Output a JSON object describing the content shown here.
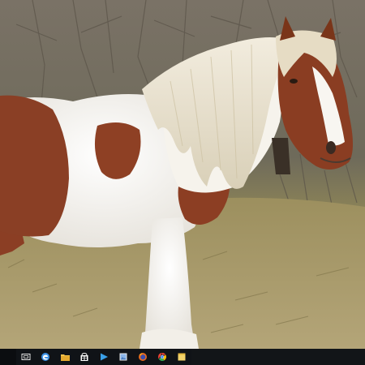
{
  "wallpaper": {
    "subject": "horse-photo",
    "colors": {
      "sky_trees": "#7d7466",
      "grass": "#9a8d5f",
      "coat_brown": "#8a3f25",
      "coat_white": "#f5f3ef",
      "mane": "#ece7d8"
    }
  },
  "taskbar": {
    "background": "#101317",
    "buttons": [
      {
        "name": "task-view",
        "icon": "task-view-icon"
      },
      {
        "name": "edge",
        "icon": "edge-icon",
        "color": "#3a8fe3"
      },
      {
        "name": "file-explorer",
        "icon": "folder-icon",
        "color": "#f1c24b"
      },
      {
        "name": "store",
        "icon": "store-icon",
        "color": "#ffffff"
      },
      {
        "name": "media-player",
        "icon": "play-icon",
        "color": "#3aa0e8"
      },
      {
        "name": "photos",
        "icon": "image-viewer-icon",
        "color": "#8ab4e8"
      },
      {
        "name": "firefox",
        "icon": "firefox-icon",
        "color": "#e66a1f"
      },
      {
        "name": "chrome",
        "icon": "chrome-icon",
        "color": "#34a853"
      },
      {
        "name": "notes",
        "icon": "sticky-note-icon",
        "color": "#f3d36b"
      }
    ]
  }
}
